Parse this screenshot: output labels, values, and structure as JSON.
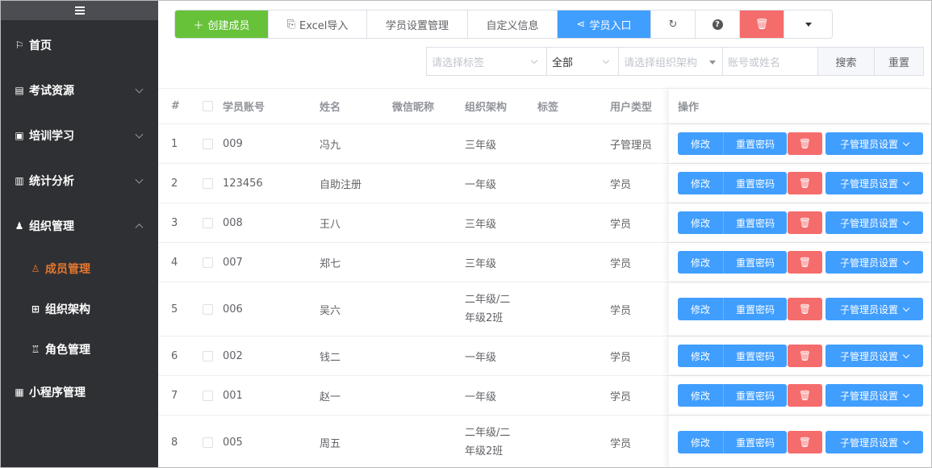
{
  "sidebar": {
    "items": [
      {
        "label": "首页",
        "icon": "flag-icon",
        "glyph": "⚐"
      },
      {
        "label": "考试资源",
        "icon": "document-icon",
        "glyph": "▤"
      },
      {
        "label": "培训学习",
        "icon": "monitor-icon",
        "glyph": "▣"
      },
      {
        "label": "统计分析",
        "icon": "chart-icon",
        "glyph": "▥"
      },
      {
        "label": "组织管理",
        "icon": "users-icon",
        "glyph": "♟"
      },
      {
        "label": "小程序管理",
        "icon": "grid-icon",
        "glyph": "▦"
      }
    ],
    "subitems": [
      {
        "label": "成员管理",
        "icon": "user-icon",
        "glyph": "♙"
      },
      {
        "label": "组织架构",
        "icon": "org-icon",
        "glyph": "⊞"
      },
      {
        "label": "角色管理",
        "icon": "role-icon",
        "glyph": "♖"
      }
    ]
  },
  "toolbar": {
    "create": "创建成员",
    "excel": "Excel导入",
    "settings": "学员设置管理",
    "custom": "自定义信息",
    "entry": "学员入口"
  },
  "filter": {
    "tag_placeholder": "请选择标签",
    "scope": "全部",
    "org_placeholder": "请选择组织架构",
    "account_placeholder": "账号或姓名",
    "search": "搜索",
    "reset": "重置"
  },
  "table": {
    "headers": {
      "index": "#",
      "account": "学员账号",
      "name": "姓名",
      "wechat": "微信昵称",
      "org": "组织架构",
      "tag": "标签",
      "type": "用户类型",
      "ops": "操作"
    },
    "rows": [
      {
        "index": "1",
        "account": "009",
        "name": "冯九",
        "org": [
          "三年级"
        ],
        "type": "子管理员"
      },
      {
        "index": "2",
        "account": "123456",
        "name": "自助注册",
        "org": [
          "一年级"
        ],
        "type": "学员"
      },
      {
        "index": "3",
        "account": "008",
        "name": "王八",
        "org": [
          "三年级"
        ],
        "type": "学员"
      },
      {
        "index": "4",
        "account": "007",
        "name": "郑七",
        "org": [
          "三年级"
        ],
        "type": "学员"
      },
      {
        "index": "5",
        "account": "006",
        "name": "吴六",
        "org": [
          "二年级/二",
          "年级2班"
        ],
        "type": "学员"
      },
      {
        "index": "6",
        "account": "002",
        "name": "钱二",
        "org": [
          "一年级"
        ],
        "type": "学员"
      },
      {
        "index": "7",
        "account": "001",
        "name": "赵一",
        "org": [
          "一年级"
        ],
        "type": "学员"
      },
      {
        "index": "8",
        "account": "005",
        "name": "周五",
        "org": [
          "二年级/二",
          "年级2班"
        ],
        "type": "学员"
      }
    ],
    "actions": {
      "edit": "修改",
      "reset_password": "重置密码",
      "admin_settings": "子管理员设置"
    }
  },
  "colors": {
    "primary": "#409eff",
    "success": "#67c23a",
    "danger": "#f56c6c",
    "active_menu": "#e6782f",
    "sidebar_bg": "#2f3033"
  }
}
